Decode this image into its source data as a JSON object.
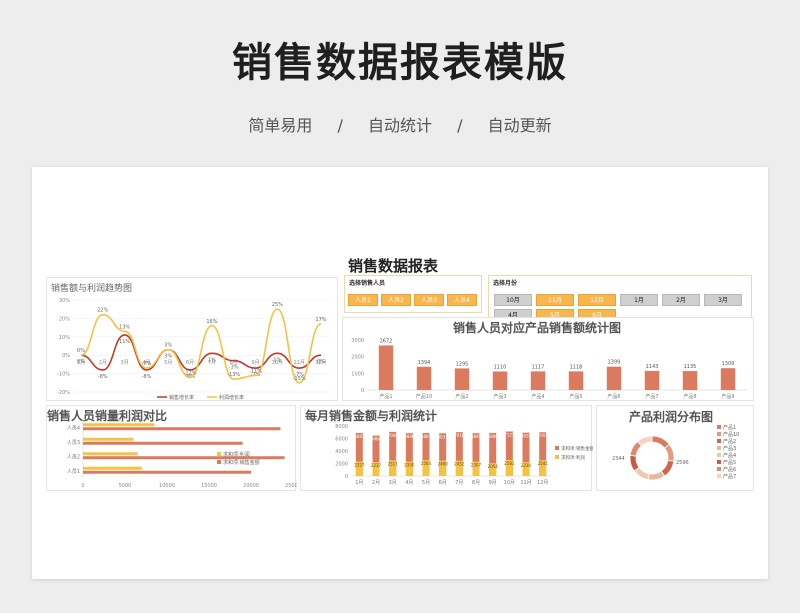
{
  "header": {
    "title": "销售数据报表模版",
    "tags": [
      "简单易用",
      "/",
      "自动统计",
      "/",
      "自动更新"
    ]
  },
  "report": {
    "title": "销售数据报表",
    "salesperson_selector": {
      "label": "选择销售人员",
      "items": [
        "人员1",
        "人员2",
        "人员3",
        "人员4"
      ]
    },
    "month_selector": {
      "label": "选择月份",
      "row1": [
        "10月",
        "11月",
        "12月",
        "1月",
        "2月",
        "3月"
      ],
      "row2": [
        "4月",
        "5月",
        "6月"
      ]
    }
  },
  "colors": {
    "accent_orange": "#f8b64c",
    "bar_red": "#dc7a5f",
    "line_red": "#c0392b",
    "line_yellow": "#f5c242",
    "grey_chip": "#cfcfcf"
  },
  "chart_data": [
    {
      "id": "trend",
      "type": "line",
      "title": "销售额与利润趋势图",
      "x": [
        "1月",
        "2月",
        "3月",
        "4月",
        "5月",
        "6月",
        "7月",
        "8月",
        "9月",
        "10月",
        "11月",
        "12月"
      ],
      "ylim": [
        -20,
        30
      ],
      "yticks": [
        "30%",
        "20%",
        "10%",
        "0%",
        "-10%",
        "-20%"
      ],
      "series": [
        {
          "name": "销售增长率",
          "values": [
            0,
            -8,
            11,
            -8,
            3,
            -8,
            1,
            -3,
            -7,
            1,
            -7,
            0
          ]
        },
        {
          "name": "利润增长率",
          "values": [
            0,
            22,
            13,
            -7,
            3,
            -12,
            16,
            -13,
            -11,
            25,
            -15,
            17
          ]
        }
      ],
      "labels": [
        "0%",
        "-8%",
        "11%",
        "-8%",
        "3%",
        "-8%",
        "1%",
        "-3%",
        "-7%",
        "1%",
        "-7%",
        "0%",
        "22%",
        "13%",
        "-7%",
        "-12%",
        "16%",
        "-13%",
        "-11%",
        "25%",
        "-15%",
        "17%"
      ]
    },
    {
      "id": "product_sales",
      "type": "bar",
      "title": "销售人员对应产品销售额统计图",
      "categories": [
        "产品1",
        "产品10",
        "产品2",
        "产品3",
        "产品4",
        "产品5",
        "产品6",
        "产品7",
        "产品8",
        "产品9"
      ],
      "values": [
        2672,
        1394,
        1295,
        1110,
        1117,
        1118,
        1399,
        1143,
        1135,
        1309
      ],
      "ylim": [
        0,
        3000
      ],
      "yticks": [
        "3000",
        "2000",
        "1000",
        "0"
      ]
    },
    {
      "id": "person_compare",
      "type": "bar",
      "title": "销售人员销量利润对比",
      "categories": [
        "人员1",
        "人员2",
        "人员3",
        "人员4"
      ],
      "series": [
        {
          "name": "求和项:利润",
          "values": [
            7000,
            6500,
            6000,
            8500
          ]
        },
        {
          "name": "求和项:销售金额",
          "values": [
            20000,
            24000,
            19000,
            23500
          ]
        }
      ],
      "xlim": [
        0,
        25000
      ],
      "xticks": [
        "0",
        "5000",
        "10000",
        "15000",
        "20000",
        "25000"
      ]
    },
    {
      "id": "monthly",
      "type": "bar",
      "title": "每月销售金额与利润统计",
      "categories": [
        "1月",
        "2月",
        "3月",
        "4月",
        "5月",
        "6月",
        "7月",
        "8月",
        "9月",
        "10月",
        "11月",
        "12月"
      ],
      "series": [
        {
          "name": "求和项:销售金额",
          "values": [
            6881,
            6464,
            7060,
            6846,
            6881,
            6831,
            7016,
            6849,
            6886,
            7121,
            6935,
            7001
          ]
        },
        {
          "name": "求和项:利润",
          "values": [
            2327,
            2237,
            2511,
            2330,
            2564,
            2490,
            2452,
            2307,
            2054,
            2581,
            2230,
            2541
          ]
        }
      ],
      "labels_top": [
        "6881",
        "6464",
        "7060",
        "6846",
        "6881",
        "6831",
        "7016",
        "6849",
        "6886",
        "7121",
        "6935",
        "7001"
      ],
      "labels_bottom": [
        "2327",
        "2237",
        "2511",
        "2330",
        "2564",
        "2490",
        "2452",
        "2307",
        "2054",
        "2581",
        "2230",
        "2541"
      ],
      "ylim": [
        0,
        8000
      ],
      "yticks": [
        "8000",
        "6000",
        "4000",
        "2000",
        "0"
      ]
    },
    {
      "id": "profit_dist",
      "type": "pie",
      "title": "产品利润分布图",
      "categories": [
        "产品1",
        "产品10",
        "产品2",
        "产品3",
        "产品4",
        "产品5",
        "产品6",
        "产品7"
      ],
      "values": [
        2596,
        2344,
        2300,
        2250,
        2200,
        2150,
        2100,
        2050
      ],
      "labels": [
        "2596",
        "2344"
      ]
    }
  ]
}
